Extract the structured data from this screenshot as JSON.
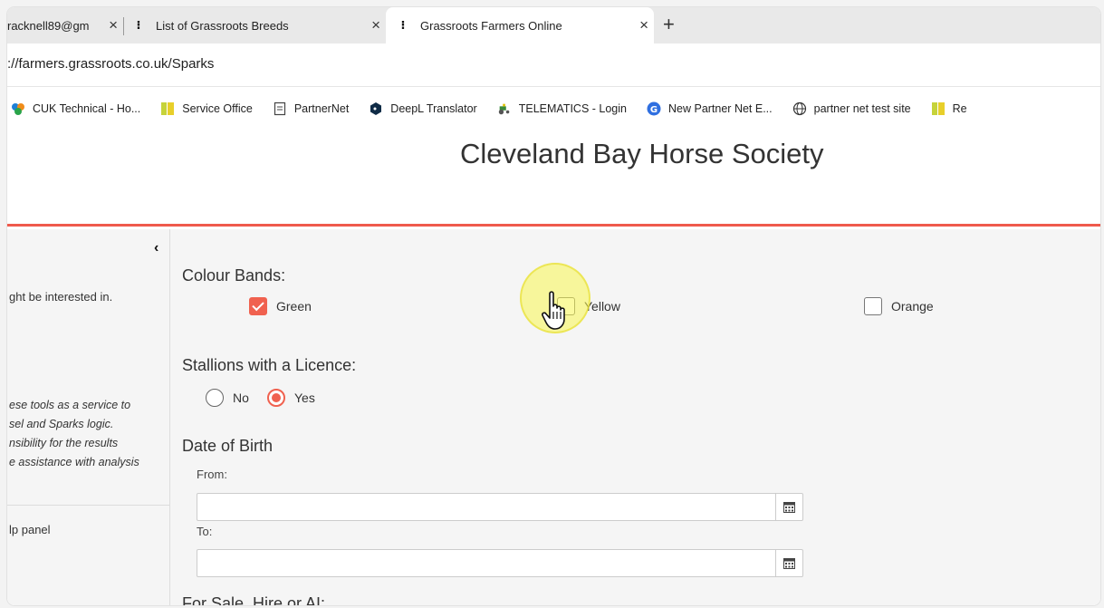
{
  "browser": {
    "tabs": [
      {
        "title": "racknell89@gm",
        "active": false
      },
      {
        "title": "List of Grassroots Breeds",
        "active": false
      },
      {
        "title": "Grassroots Farmers Online",
        "active": true
      }
    ],
    "url": "://farmers.grassroots.co.uk/Sparks",
    "bookmarks": [
      {
        "label": "CUK Technical - Ho...",
        "icon": "cuk-icon"
      },
      {
        "label": "Service Office",
        "icon": "yellow-folder-icon"
      },
      {
        "label": "PartnerNet",
        "icon": "document-icon"
      },
      {
        "label": "DeepL Translator",
        "icon": "deepl-icon"
      },
      {
        "label": "TELEMATICS - Login",
        "icon": "tractor-icon"
      },
      {
        "label": "New Partner Net E...",
        "icon": "g-icon"
      },
      {
        "label": "partner net test site",
        "icon": "globe-icon"
      },
      {
        "label": "Re",
        "icon": "yellow-folder-icon"
      }
    ]
  },
  "page": {
    "title": "Cleveland Bay Horse Society",
    "accent": "#f0614f"
  },
  "sidebar": {
    "text1": "ght be interested in.",
    "italic_lines": [
      "ese tools as a service to",
      "sel and Sparks logic.",
      "nsibility for the results",
      "e assistance with analysis"
    ],
    "text2": "lp panel"
  },
  "form": {
    "colour_bands": {
      "label": "Colour Bands:",
      "options": [
        {
          "label": "Green",
          "checked": true
        },
        {
          "label": "Yellow",
          "checked": false
        },
        {
          "label": "Orange",
          "checked": false
        }
      ]
    },
    "stallions": {
      "label": "Stallions with a Licence:",
      "options": [
        {
          "label": "No",
          "selected": false
        },
        {
          "label": "Yes",
          "selected": true
        }
      ]
    },
    "dob": {
      "label": "Date of Birth",
      "from_label": "From:",
      "to_label": "To:",
      "from_value": "",
      "to_value": ""
    },
    "next_section_label": "For Sale, Hire or AI:"
  }
}
